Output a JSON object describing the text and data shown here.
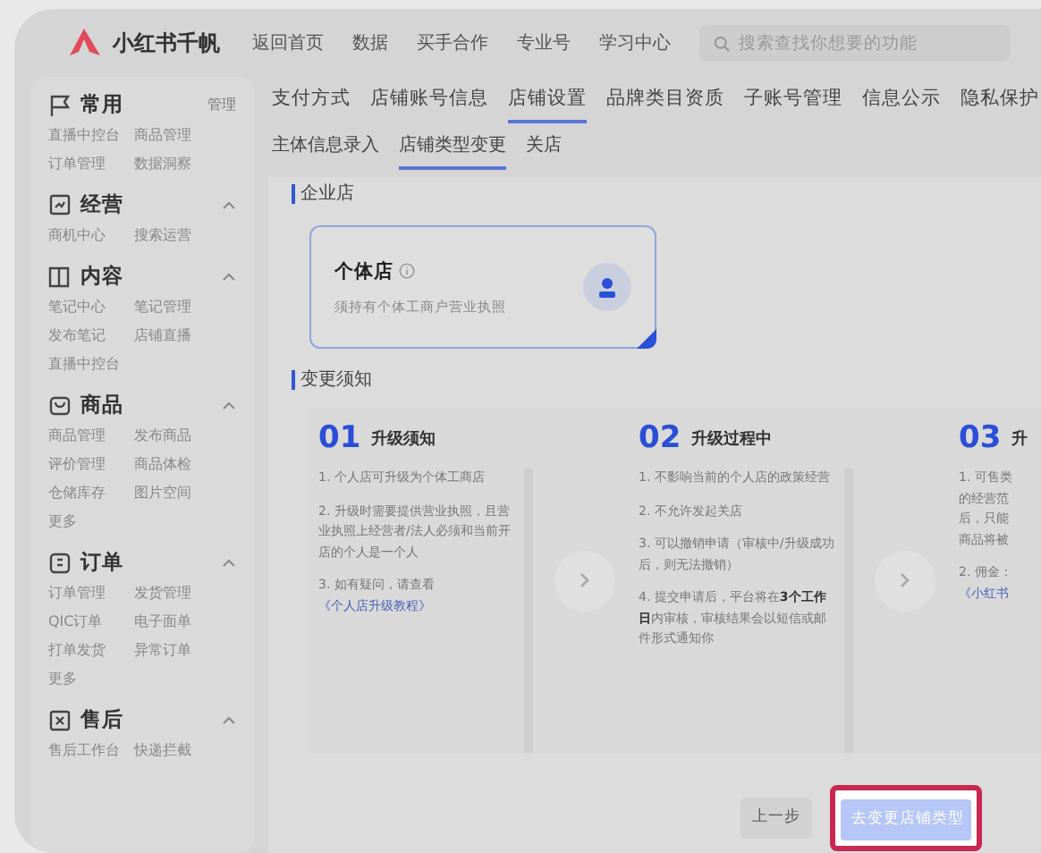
{
  "header": {
    "brand": "小红书千帆",
    "nav": [
      "返回首页",
      "数据",
      "买手合作",
      "专业号",
      "学习中心"
    ],
    "search": {
      "placeholder": "搜索查找你想要的功能"
    }
  },
  "sidebar": {
    "sections": [
      {
        "title": "常用",
        "action": "管理",
        "items": [
          "直播中控台",
          "商品管理",
          "订单管理",
          "数据洞察"
        ]
      },
      {
        "title": "经营",
        "expanded": true,
        "items": [
          "商机中心",
          "搜索运营"
        ]
      },
      {
        "title": "内容",
        "expanded": true,
        "items": [
          "笔记中心",
          "笔记管理",
          "发布笔记",
          "店铺直播",
          "直播中控台"
        ]
      },
      {
        "title": "商品",
        "expanded": true,
        "items": [
          "商品管理",
          "发布商品",
          "评价管理",
          "商品体检",
          "仓储库存",
          "图片空间",
          "更多"
        ]
      },
      {
        "title": "订单",
        "expanded": true,
        "items": [
          "订单管理",
          "发货管理",
          "QIC订单",
          "电子面单",
          "打单发货",
          "异常订单",
          "更多"
        ]
      },
      {
        "title": "售后",
        "expanded": true,
        "items": [
          "售后工作台",
          "快递拦截"
        ]
      }
    ]
  },
  "tabs": [
    {
      "label": "支付方式",
      "selected": false
    },
    {
      "label": "店铺账号信息",
      "selected": false
    },
    {
      "label": "店铺设置",
      "selected": true
    },
    {
      "label": "品牌类目资质",
      "selected": false
    },
    {
      "label": "子账号管理",
      "selected": false
    },
    {
      "label": "信息公示",
      "selected": false
    },
    {
      "label": "隐私保护",
      "selected": false
    }
  ],
  "subtabs": [
    {
      "label": "主体信息录入",
      "selected": false
    },
    {
      "label": "店铺类型变更",
      "selected": true
    },
    {
      "label": "关店",
      "selected": false
    }
  ],
  "section_title": "企业店",
  "store_card": {
    "title": "个体店",
    "description": "须持有个体工商户营业执照",
    "selected": true
  },
  "notice_title": "变更须知",
  "steps": [
    {
      "number": "01",
      "title": "升级须知",
      "items": [
        {
          "text": "1. 个人店可升级为个体工商店"
        },
        {
          "text": "2. 升级时需要提供营业执照，且营业执照上经营者/法人必须和当前开店的个人是一个人"
        },
        {
          "text": "3. 如有疑问，请查看",
          "link": "《个人店升级教程》"
        }
      ]
    },
    {
      "number": "02",
      "title": "升级过程中",
      "items": [
        {
          "text": "1. 不影响当前的个人店的政策经营"
        },
        {
          "text": "2. 不允许发起关店"
        },
        {
          "text": "3. 可以撤销申请（审核中/升级成功后，则无法撤销）"
        },
        {
          "text": "4. 提交申请后，平台将在**3个工作日**内审核，审核结果会以短信或邮件形式通知你"
        }
      ]
    },
    {
      "number": "03",
      "title": "升",
      "items": [
        {
          "lines": [
            "1. 可售类",
            "的经营范",
            "后，只能",
            "商品将被"
          ]
        },
        {
          "lines": [
            "2. 佣金："
          ],
          "link": "《小红书"
        }
      ]
    }
  ],
  "buttons": {
    "back": "上一步",
    "primary": "去变更店铺类型"
  }
}
